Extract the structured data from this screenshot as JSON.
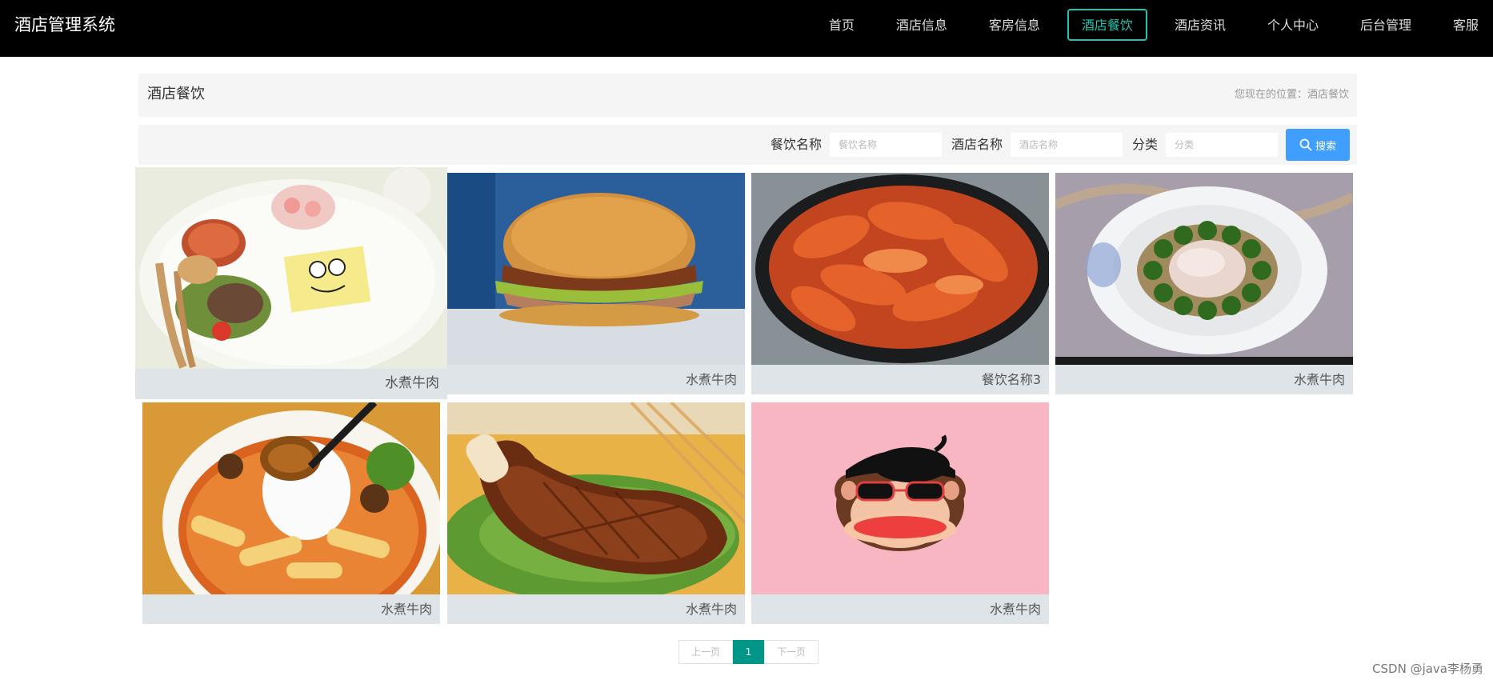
{
  "header": {
    "brand": "酒店管理系统",
    "nav": [
      "首页",
      "酒店信息",
      "客房信息",
      "酒店餐饮",
      "酒店资讯",
      "个人中心",
      "后台管理",
      "客服"
    ],
    "active_index": 3
  },
  "title_bar": {
    "title": "酒店餐饮",
    "breadcrumb": "您现在的位置：酒店餐饮"
  },
  "search": {
    "dish_label": "餐饮名称",
    "dish_placeholder": "餐饮名称",
    "hotel_label": "酒店名称",
    "hotel_placeholder": "酒店名称",
    "category_label": "分类",
    "category_placeholder": "分类",
    "button_label": "搜索"
  },
  "items": [
    {
      "name": "水煮牛肉",
      "image": "plate-lunch-with-sponge-cake"
    },
    {
      "name": "水煮牛肉",
      "image": "burger"
    },
    {
      "name": "餐饮名称3",
      "image": "braised-shrimp"
    },
    {
      "name": "水煮牛肉",
      "image": "abalone-with-broccoli"
    },
    {
      "name": "水煮牛肉",
      "image": "abalone-rice-bowl"
    },
    {
      "name": "水煮牛肉",
      "image": "roasted-duck-leg"
    },
    {
      "name": "水煮牛肉",
      "image": "monkey-face-illustration"
    }
  ],
  "pagination": {
    "prev": "上一页",
    "current": "1",
    "next": "下一页"
  },
  "watermark": "CSDN @java李杨勇",
  "colors": {
    "header_bg": "#000000",
    "accent": "#20c4b0",
    "search_button": "#409eff",
    "pager_active": "#009688"
  }
}
